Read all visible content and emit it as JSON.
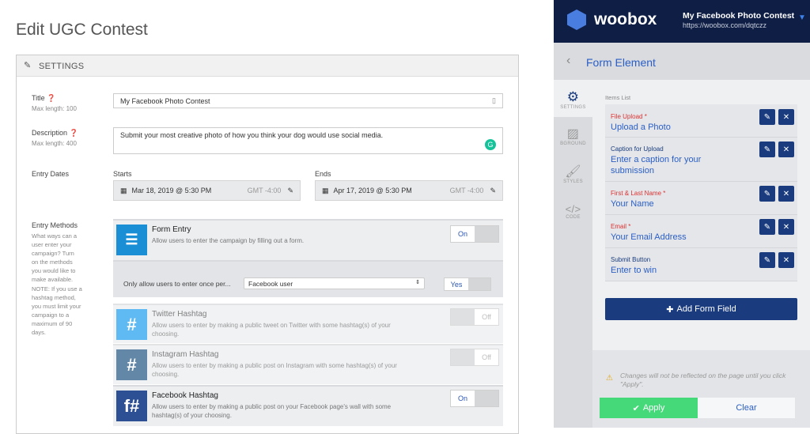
{
  "page_title": "Edit UGC Contest",
  "settings": {
    "header": "SETTINGS",
    "title": {
      "label": "Title",
      "help": "Max length: 100",
      "value": "My Facebook Photo Contest"
    },
    "description": {
      "label": "Description",
      "help": "Max length: 400",
      "value": "Submit your most creative photo of how you think your dog would use social media."
    },
    "entry_dates": {
      "label": "Entry Dates",
      "starts_label": "Starts",
      "starts": "Mar 18, 2019 @ 5:30 PM",
      "ends_label": "Ends",
      "ends": "Apr 17, 2019 @ 5:30 PM",
      "tz": "GMT -4:00"
    },
    "entry_methods": {
      "label": "Entry Methods",
      "help": "What ways can a user enter your campaign? Turn on the methods you would like to make available.",
      "note": "NOTE: If you use a hashtag method, you must limit your campaign to a maximum of 90 days.",
      "methods": [
        {
          "title": "Form Entry",
          "desc": "Allow users to enter the campaign by filling out a form.",
          "toggle": "On",
          "color": "#1b8fd6"
        },
        {
          "title": "Twitter Hashtag",
          "desc": "Allow users to enter by making a public tweet on Twitter with some hashtag(s) of your choosing.",
          "toggle": "Off",
          "color": "#2aa3ef"
        },
        {
          "title": "Instagram Hashtag",
          "desc": "Allow users to enter by making a public post on Instagram with some hashtag(s) of your choosing.",
          "toggle": "Off",
          "color": "#2e5f8a"
        },
        {
          "title": "Facebook Hashtag",
          "desc": "Allow users to enter by making a public post on your Facebook page's wall with some hashtag(s) of your choosing.",
          "toggle": "On",
          "color": "#2d4f93"
        }
      ],
      "once_per_label": "Only allow users to enter once per...",
      "once_per_value": "Facebook user",
      "once_per_toggle": "Yes"
    }
  },
  "editor": {
    "brand": "woobox",
    "contest_name": "My Facebook Photo Contest",
    "contest_url": "https://woobox.com/dqtczz",
    "panel_title": "Form Element",
    "side_tabs": [
      "SETTINGS",
      "BGROUND",
      "STYLES",
      "CODE"
    ],
    "items_label": "Items List",
    "items": [
      {
        "label": "File Upload *",
        "value": "Upload a Photo",
        "required": true
      },
      {
        "label": "Caption for Upload",
        "value": "Enter a caption for your submission",
        "required": false
      },
      {
        "label": "First & Last Name *",
        "value": "Your Name",
        "required": true
      },
      {
        "label": "Email *",
        "value": "Your Email Address",
        "required": true
      },
      {
        "label": "Submit Button",
        "value": "Enter to win",
        "required": false
      }
    ],
    "add_button": "Add Form Field",
    "warning": "Changes will not be reflected on the page until you click \"Apply\".",
    "apply": "Apply",
    "clear": "Clear"
  }
}
